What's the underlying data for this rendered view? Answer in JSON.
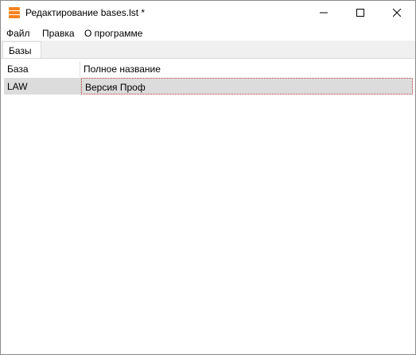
{
  "window": {
    "title": "Редактирование bases.lst *",
    "controls": [
      "minimize-icon",
      "maximize-icon",
      "close-icon"
    ]
  },
  "menu": {
    "file": "Файл",
    "edit": "Правка",
    "about": "О программе"
  },
  "tabs": [
    {
      "label": "Базы",
      "active": true
    }
  ],
  "table": {
    "columns": [
      "База",
      "Полное название"
    ],
    "rows": [
      {
        "base": "LAW",
        "full_name": "Версия Проф",
        "selected": true
      }
    ]
  },
  "colors": {
    "accent_icon": "#f5821f",
    "selected_row": "#dcdcdc",
    "focus_border": "#c43a3a"
  }
}
